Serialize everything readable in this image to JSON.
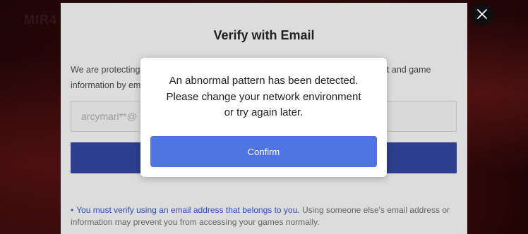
{
  "background": {
    "logo_text": "MIR4"
  },
  "panel": {
    "title": "Verify with Email",
    "description": "We are protecting your account and game information. Please verify your account and game information by email verification.",
    "email_value": "arcymari**@",
    "note_highlight": "You must verify using an email address that belongs to you.",
    "note_rest": " Using someone else's email address or information may prevent you from accessing your games normally."
  },
  "modal": {
    "lines": [
      "An abnormal pattern has been detected.",
      "Please change your network environment",
      "or try again later."
    ],
    "confirm_label": "Confirm"
  },
  "icons": {
    "close": "close-icon"
  },
  "colors": {
    "confirm": "#4f74e3",
    "panel_button": "#2d3f8e",
    "note_link": "#2d4fbf"
  }
}
